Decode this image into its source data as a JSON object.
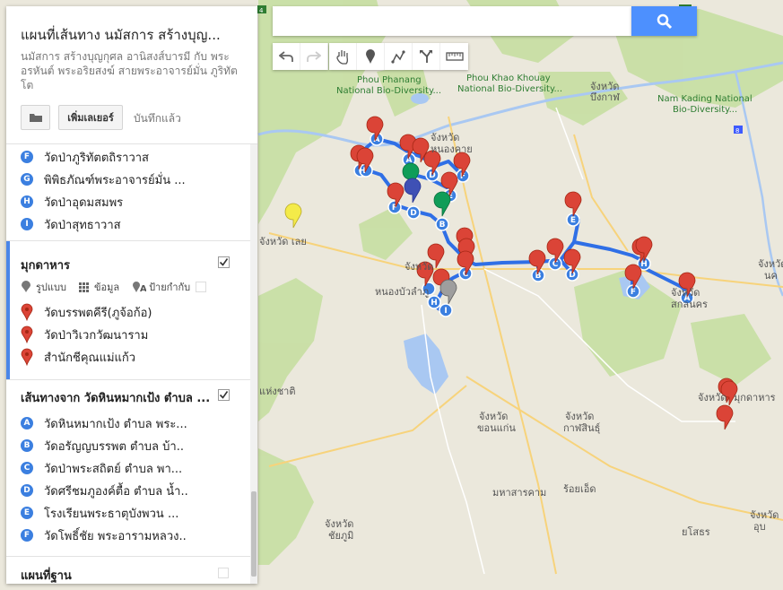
{
  "app": {
    "title": "แผนที่เส้นทาง นมัสการ สร้างบุญ...",
    "description": "นมัสการ สร้างบุญกุศล อานิสงส์บารมี กับ พระอรหันต์ พระอริยสงฆ์ สายพระอาจารย์มั่น ภูริทัตโต",
    "add_layer_label": "เพิ่มเลเยอร์",
    "saved_label": "บันทึกแล้ว"
  },
  "layer1": {
    "items": [
      {
        "letter": "F",
        "label": "วัดป่าภูริทัตตถิราวาส"
      },
      {
        "letter": "G",
        "label": "พิพิธภัณฑ์พระอาจารย์มั่น ..."
      },
      {
        "letter": "H",
        "label": "วัดป่าอุดมสมพร"
      },
      {
        "letter": "I",
        "label": "วัดป่าสุทธาวาส"
      }
    ]
  },
  "layer2": {
    "title": "มุกดาหาร",
    "tools": {
      "style": "รูปแบบ",
      "data": "ข้อมูล",
      "labels": "ป้ายกำกับ"
    },
    "items": [
      {
        "label": "วัดบรรพตคีรี(ภูจ้อก้อ)"
      },
      {
        "label": "วัดป่าวิเวกวัฒนาราม"
      },
      {
        "label": "สำนักชีคุณแม่แก้ว"
      }
    ]
  },
  "layer3": {
    "title": "เส้นทางจาก วัดหินหมากเป้ง ตำบล ...",
    "items": [
      {
        "letter": "A",
        "label": "วัดหินหมากเป้ง ตำบล พระ..."
      },
      {
        "letter": "B",
        "label": "วัดอรัญญบรรพต ตำบล บ้า.."
      },
      {
        "letter": "C",
        "label": "วัดป่าพระสถิตย์ ตำบล พา..."
      },
      {
        "letter": "D",
        "label": "วัดศรีชมภูองค์ตื้อ ตำบล น้ำ.."
      },
      {
        "letter": "E",
        "label": "โรงเรียนพระธาตุบังพวน ..."
      },
      {
        "letter": "F",
        "label": "วัดโพธิ์ชัย พระอารามหลวง.."
      }
    ]
  },
  "base_layer": {
    "title": "แผนที่ฐาน"
  },
  "map_labels": {
    "nongkhai": "จังหวัด\nหนองคาย",
    "udon": "จังหวัด\nอุดรธานี",
    "loei": "จังหวัด เลย",
    "bueng": "จังหวัด\nบึงกาฬ",
    "sakon": "จังหวัด\nสกลนคร",
    "nongbua": "จังหวัด\nหนองบัวลำภู",
    "khonkaen": "จังหวัด\nขอนแก่น",
    "kalasin": "จังหวัด\nกาฬสินธุ์",
    "chaiyaphum": "จังหวัด\nชัยภูมิ",
    "mahasarakham": "มหาสารคาม",
    "roiet": "ร้อยเอ็ด",
    "yasothon": "ยโสธร",
    "mukdahan": "จังหวัด\nมุกดาหาร",
    "nakhon": "จังหวัด\nนค",
    "phou_phanang": "Phou Phanang\nNational Bio-Diversity...",
    "phou_khao": "Phou Khao Khouay\nNational Bio-Diversity...",
    "nam_kading": "Nam Kading National\nBio-Diversity...",
    "ubon": "จังหวัด\nอุบ",
    "chaiyaphum2": "แห่งชาติ"
  },
  "colors": {
    "route": "#2f6fe6",
    "marker_red": "#db4437",
    "marker_blue": "#3b7fe0",
    "marker_yellow": "#f4eb49",
    "marker_green": "#0f9d58"
  },
  "icons": [
    "folder-icon",
    "search-icon",
    "undo-icon",
    "redo-icon",
    "hand-icon",
    "marker-icon",
    "shape-icon",
    "route-icon",
    "ruler-icon",
    "checkbox-icon",
    "style-icon",
    "data-icon",
    "label-icon",
    "pin-icon"
  ]
}
